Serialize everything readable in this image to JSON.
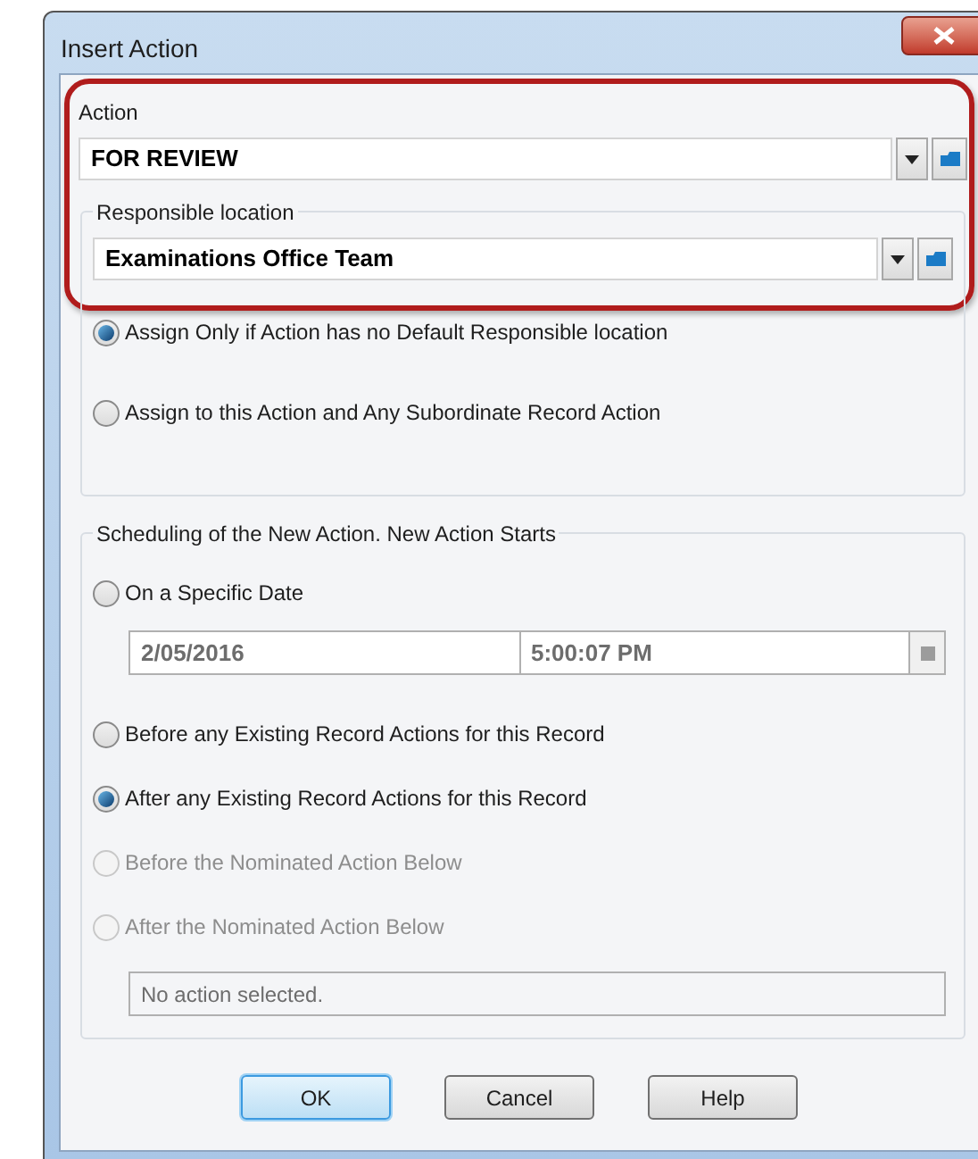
{
  "window": {
    "title": "Insert Action"
  },
  "action": {
    "label": "Action",
    "value": "FOR REVIEW"
  },
  "responsible": {
    "label": "Responsible location",
    "value": "Examinations Office Team",
    "options": [
      {
        "label": "Assign Only if Action has no Default Responsible location",
        "selected": true
      },
      {
        "label": "Assign to this Action and Any Subordinate Record Action",
        "selected": false
      }
    ]
  },
  "scheduling": {
    "label": "Scheduling of the New Action.  New Action Starts",
    "specific_date": {
      "label": "On a Specific Date",
      "selected": false,
      "disabled": false
    },
    "date": "2/05/2016",
    "time": "5:00:07 PM",
    "options": [
      {
        "label": "Before any Existing Record Actions for this Record",
        "selected": false,
        "disabled": false
      },
      {
        "label": "After any Existing Record Actions for this Record",
        "selected": true,
        "disabled": false
      },
      {
        "label": "Before the Nominated Action Below",
        "selected": false,
        "disabled": true
      },
      {
        "label": "After the Nominated Action Below",
        "selected": false,
        "disabled": true
      }
    ],
    "nominated_action": "No action selected."
  },
  "buttons": [
    {
      "label": "OK",
      "default": true
    },
    {
      "label": "Cancel",
      "default": false
    },
    {
      "label": "Help",
      "default": false
    }
  ]
}
